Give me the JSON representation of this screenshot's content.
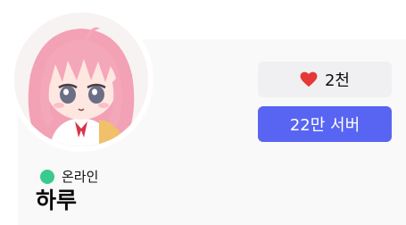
{
  "profile": {
    "status": {
      "text": "온라인",
      "color": "#3ac98f"
    },
    "username": "하루",
    "likes": {
      "count": "2천",
      "icon": "heart-icon",
      "icon_color": "#e53935"
    },
    "servers_button": {
      "label": "22만 서버",
      "color": "#5865f2"
    },
    "avatar": {
      "description_icon": "anime-avatar"
    }
  }
}
